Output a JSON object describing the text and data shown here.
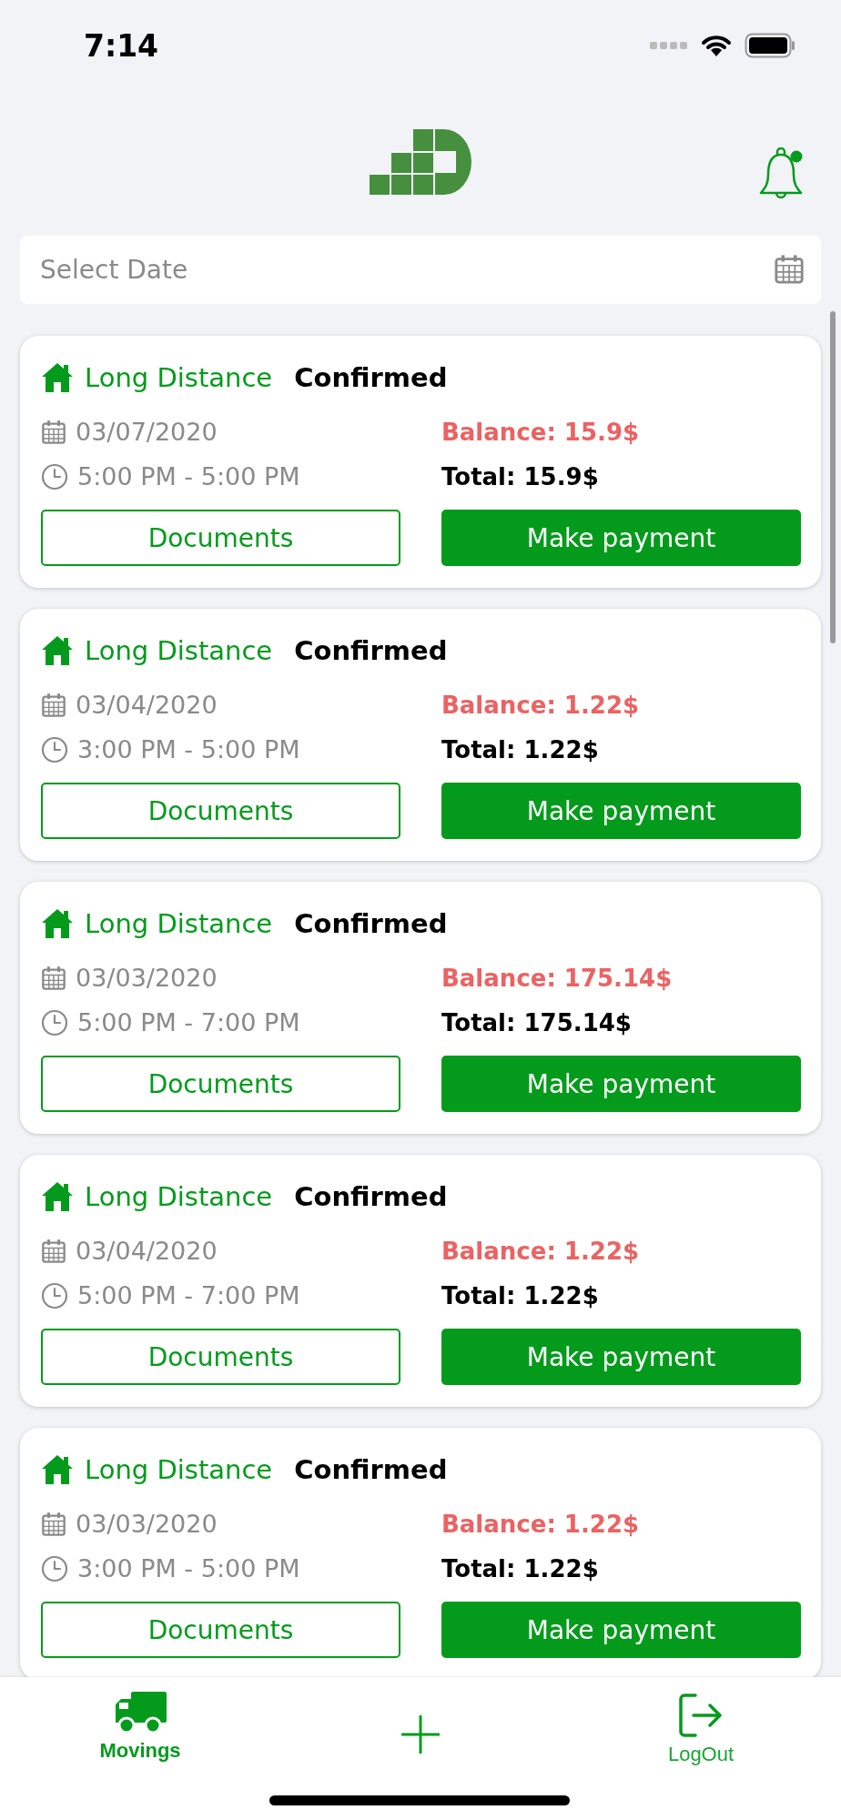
{
  "status_bar": {
    "time": "7:14"
  },
  "date_field": {
    "placeholder": "Select Date"
  },
  "notifications": {
    "unread": true
  },
  "movings": [
    {
      "type": "Long Distance",
      "status": "Confirmed",
      "date": "03/07/2020",
      "time": "5:00 PM - 5:00 PM",
      "balance": "Balance: 15.9$",
      "total": "Total: 15.9$",
      "documents": "Documents",
      "pay": "Make payment"
    },
    {
      "type": "Long Distance",
      "status": "Confirmed",
      "date": "03/04/2020",
      "time": "3:00 PM - 5:00 PM",
      "balance": "Balance: 1.22$",
      "total": "Total: 1.22$",
      "documents": "Documents",
      "pay": "Make payment"
    },
    {
      "type": "Long Distance",
      "status": "Confirmed",
      "date": "03/03/2020",
      "time": "5:00 PM - 7:00 PM",
      "balance": "Balance: 175.14$",
      "total": "Total: 175.14$",
      "documents": "Documents",
      "pay": "Make payment"
    },
    {
      "type": "Long Distance",
      "status": "Confirmed",
      "date": "03/04/2020",
      "time": "5:00 PM - 7:00 PM",
      "balance": "Balance: 1.22$",
      "total": "Total: 1.22$",
      "documents": "Documents",
      "pay": "Make payment"
    },
    {
      "type": "Long Distance",
      "status": "Confirmed",
      "date": "03/03/2020",
      "time": "3:00 PM - 5:00 PM",
      "balance": "Balance: 1.22$",
      "total": "Total: 1.22$",
      "documents": "Documents",
      "pay": "Make payment"
    }
  ],
  "tab_bar": [
    {
      "kind": "truck",
      "label": "Movings",
      "selected": true
    },
    {
      "kind": "plus",
      "selected": false
    },
    {
      "kind": "logout",
      "label": "LogOut",
      "selected": false
    }
  ]
}
